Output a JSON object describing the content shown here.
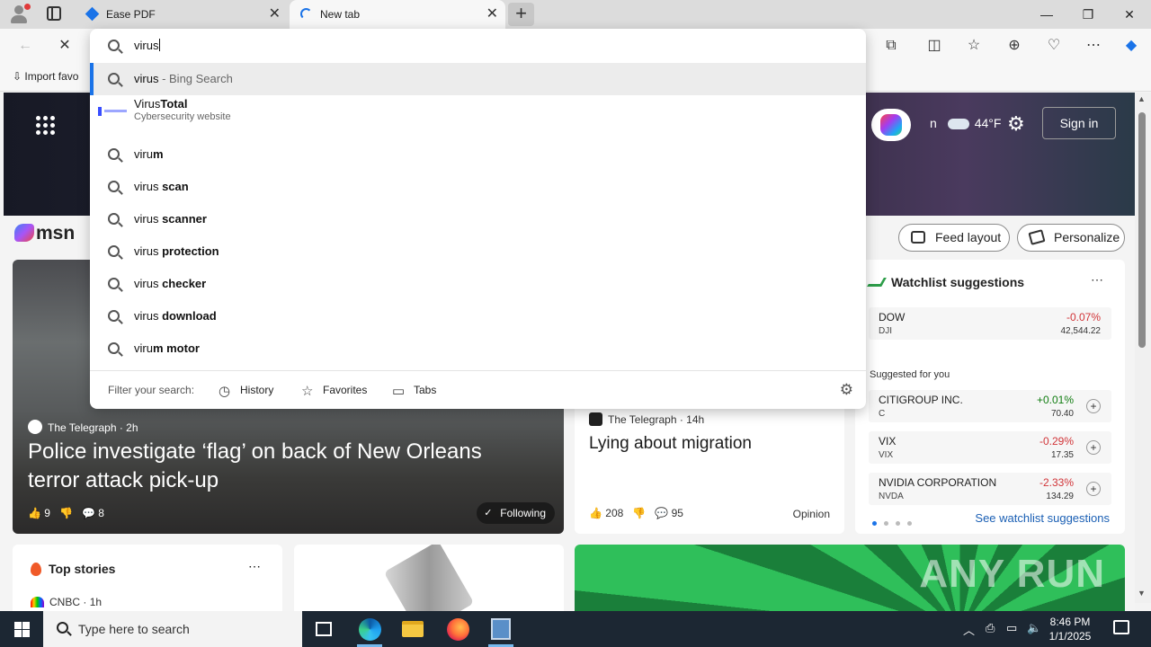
{
  "browser": {
    "tabs": [
      {
        "title": "Ease PDF",
        "favicon": "easepdf-diamond-icon",
        "active": false
      },
      {
        "title": "New tab",
        "favicon": "loading-spinner-icon",
        "active": true
      }
    ],
    "new_tab_label": "+",
    "window_controls": {
      "minimize": "—",
      "maximize": "❐",
      "close": "✕"
    },
    "favorites_bar": {
      "import_label": "Import favo"
    }
  },
  "omnibox": {
    "query": "virus",
    "suggestions": [
      {
        "type": "search",
        "prefix": "virus",
        "bold": "",
        "suffix": " - Bing Search",
        "highlighted": true
      },
      {
        "type": "site",
        "title_prefix": "Virus",
        "title_bold": "Total",
        "subtitle": "Cybersecurity website"
      },
      {
        "type": "search",
        "prefix": "viru",
        "bold": "m",
        "suffix": ""
      },
      {
        "type": "search",
        "prefix": "virus ",
        "bold": "scan",
        "suffix": ""
      },
      {
        "type": "search",
        "prefix": "virus ",
        "bold": "scanner",
        "suffix": ""
      },
      {
        "type": "search",
        "prefix": "virus ",
        "bold": "protection",
        "suffix": ""
      },
      {
        "type": "search",
        "prefix": "virus ",
        "bold": "checker",
        "suffix": ""
      },
      {
        "type": "search",
        "prefix": "virus ",
        "bold": "download",
        "suffix": ""
      },
      {
        "type": "search",
        "prefix": "viru",
        "bold": "m motor",
        "suffix": ""
      }
    ],
    "footer": {
      "label": "Filter your search:",
      "filters": [
        "History",
        "Favorites",
        "Tabs"
      ]
    }
  },
  "msn": {
    "logo": "msn",
    "weather": {
      "temp": "44°F",
      "partial_text": "n"
    },
    "signin": "Sign in",
    "feed_layout": "Feed layout",
    "personalize": "Personalize",
    "hero_story": {
      "source": "The Telegraph",
      "age": "2h",
      "headline": "Police investigate ‘flag’ on back of New Orleans terror attack pick-up",
      "likes": "9",
      "comments": "8",
      "following": "Following"
    },
    "opinion_story": {
      "source": "The Telegraph",
      "age": "14h",
      "headline": "Lying about migration",
      "likes": "208",
      "comments": "95",
      "tag": "Opinion"
    },
    "watchlist": {
      "title": "Watchlist suggestions",
      "suggested_label": "Suggested for you",
      "see_more": "See watchlist suggestions",
      "stocks": [
        {
          "name": "DOW",
          "ticker": "DJI",
          "change": "-0.07%",
          "price": "42,544.22",
          "direction": "down"
        },
        {
          "name": "CITIGROUP INC.",
          "ticker": "C",
          "change": "+0.01%",
          "price": "70.40",
          "direction": "up"
        },
        {
          "name": "VIX",
          "ticker": "VIX",
          "change": "-0.29%",
          "price": "17.35",
          "direction": "down"
        },
        {
          "name": "NVIDIA CORPORATION",
          "ticker": "NVDA",
          "change": "-2.33%",
          "price": "134.29",
          "direction": "down"
        }
      ]
    },
    "top_stories": {
      "title": "Top stories",
      "source": "CNBC",
      "age": "1h"
    },
    "watermark": "ANY RUN"
  },
  "taskbar": {
    "search_placeholder": "Type here to search",
    "time": "8:46 PM",
    "date": "1/1/2025"
  },
  "colors": {
    "accent": "#1a73e8",
    "negative": "#d13438",
    "positive": "#107c10",
    "taskbar": "#1c2733"
  }
}
